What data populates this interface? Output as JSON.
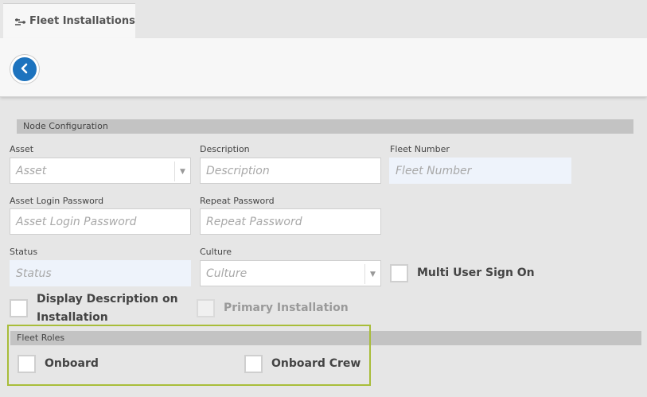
{
  "tabs": [
    {
      "label": "Fleet Installations",
      "icon": "fleet-icon"
    }
  ],
  "toolbar": {
    "back_icon": "chevron-left-icon",
    "accent": "#1d73be"
  },
  "node_configuration": {
    "title": "Node Configuration",
    "asset": {
      "label": "Asset",
      "placeholder": "Asset"
    },
    "description": {
      "label": "Description",
      "placeholder": "Description"
    },
    "fleet_number": {
      "label": "Fleet Number",
      "placeholder": "Fleet Number"
    },
    "asset_login_password": {
      "label": "Asset Login Password",
      "placeholder": "Asset Login Password"
    },
    "repeat_password": {
      "label": "Repeat Password",
      "placeholder": "Repeat Password"
    },
    "status": {
      "label": "Status",
      "placeholder": "Status"
    },
    "culture": {
      "label": "Culture",
      "placeholder": "Culture"
    },
    "multi_user_sign_on": {
      "label": "Multi User Sign On",
      "checked": false
    },
    "display_description": {
      "label_line1": "Display Description on",
      "label_line2": "Installation",
      "checked": false
    },
    "primary_installation": {
      "label": "Primary Installation",
      "checked": false,
      "disabled": true
    }
  },
  "fleet_roles": {
    "title": "Fleet Roles",
    "onboard": {
      "label": "Onboard",
      "checked": false
    },
    "onboard_crew": {
      "label": "Onboard Crew",
      "checked": false
    },
    "highlight_color": "#a8bd3a"
  }
}
